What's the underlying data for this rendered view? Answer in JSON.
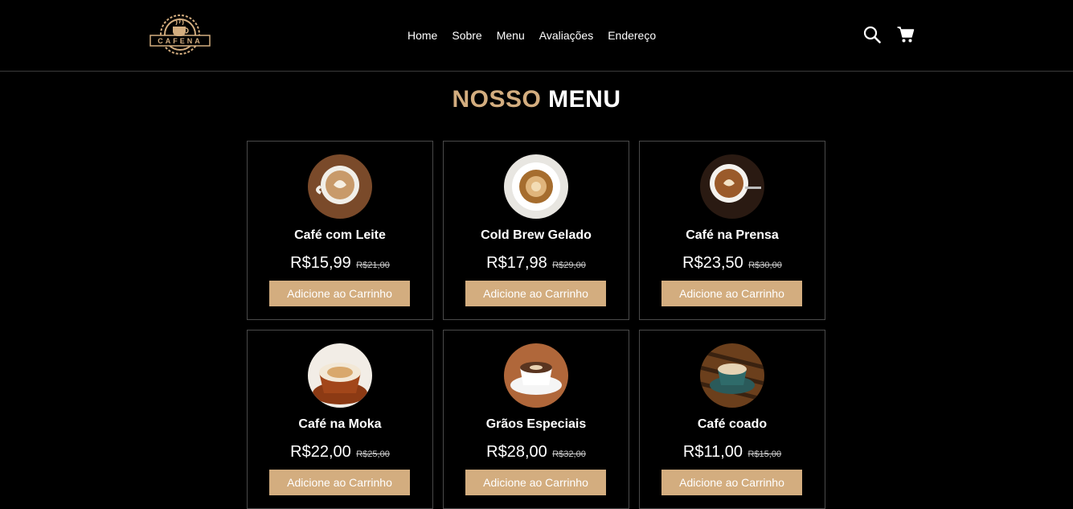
{
  "header": {
    "logo_text": "CAFENA",
    "nav": [
      "Home",
      "Sobre",
      "Menu",
      "Avaliações",
      "Endereço"
    ],
    "icons": [
      "search-icon",
      "cart-icon"
    ]
  },
  "menu_section": {
    "title_accent": "NOSSO",
    "title_rest": "MENU",
    "accent_color": "#d3ad7f",
    "items": [
      {
        "name": "Café com Leite",
        "price": "R$15,99",
        "old_price": "R$21,00",
        "button": "Adicione ao Carrinho"
      },
      {
        "name": "Cold Brew Gelado",
        "price": "R$17,98",
        "old_price": "R$29,00",
        "button": "Adicione ao Carrinho"
      },
      {
        "name": "Café na Prensa",
        "price": "R$23,50",
        "old_price": "R$30,00",
        "button": "Adicione ao Carrinho"
      },
      {
        "name": "Café na Moka",
        "price": "R$22,00",
        "old_price": "R$25,00",
        "button": "Adicione ao Carrinho"
      },
      {
        "name": "Grãos Especiais",
        "price": "R$28,00",
        "old_price": "R$32,00",
        "button": "Adicione ao Carrinho"
      },
      {
        "name": "Café coado",
        "price": "R$11,00",
        "old_price": "R$15,00",
        "button": "Adicione ao Carrinho"
      }
    ]
  }
}
